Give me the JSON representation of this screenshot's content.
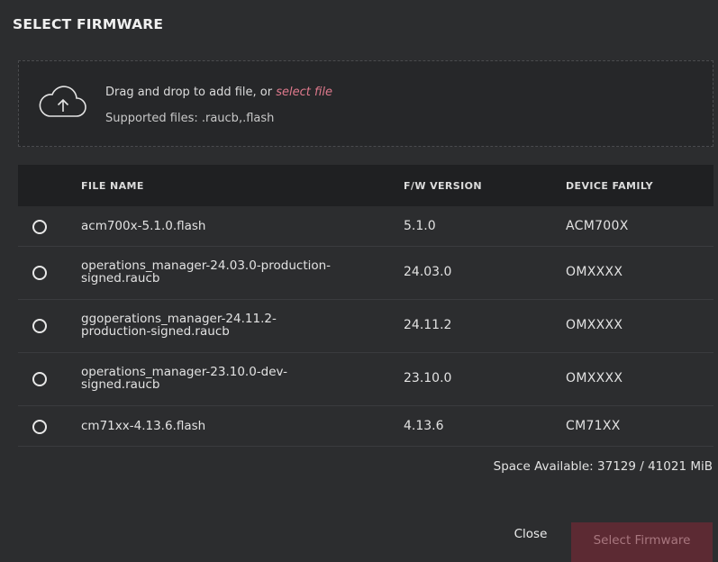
{
  "dialog": {
    "title": "SELECT FIRMWARE"
  },
  "dropzone": {
    "icon": "cloud-upload-icon",
    "prefix": "Drag and drop to add file, or ",
    "link_label": "select file",
    "supported": "Supported files: .raucb,.flash"
  },
  "table": {
    "headers": [
      "FILE NAME",
      "F/W VERSION",
      "DEVICE FAMILY"
    ],
    "rows": [
      {
        "file": "acm700x-5.1.0.flash",
        "version": "5.1.0",
        "family": "ACM700X",
        "selected": false
      },
      {
        "file": "operations_manager-24.03.0-production-signed.raucb",
        "version": "24.03.0",
        "family": "OMXXXX",
        "selected": false
      },
      {
        "file": "ggoperations_manager-24.11.2-production-signed.raucb",
        "version": "24.11.2",
        "family": "OMXXXX",
        "selected": false
      },
      {
        "file": "operations_manager-23.10.0-dev-signed.raucb",
        "version": "23.10.0",
        "family": "OMXXXX",
        "selected": false
      },
      {
        "file": "cm71xx-4.13.6.flash",
        "version": "4.13.6",
        "family": "CM71XX",
        "selected": false
      }
    ]
  },
  "footer": {
    "space_available": "Space Available: 37129 / 41021 MiB",
    "close_label": "Close",
    "select_label": "Select Firmware"
  },
  "colors": {
    "accent_link": "#e07a8d",
    "disabled_button": "#5c2a33"
  }
}
